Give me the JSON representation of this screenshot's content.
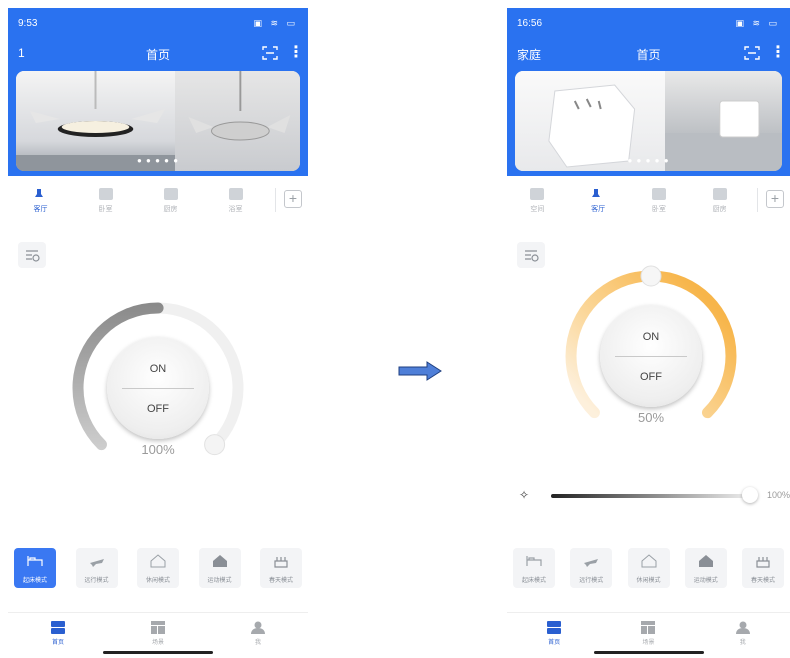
{
  "left_screen": {
    "status": {
      "time": "9:53"
    },
    "appbar": {
      "home_name": "1",
      "title": "首页"
    },
    "rooms": [
      {
        "label": "客厅",
        "active": true
      },
      {
        "label": "卧室",
        "active": false
      },
      {
        "label": "厨房",
        "active": false
      },
      {
        "label": "浴室",
        "active": false
      }
    ],
    "dial": {
      "on_label": "ON",
      "off_label": "OFF",
      "percent_text": "100%"
    },
    "modes": [
      {
        "label": "起床模式",
        "active": true,
        "icon": "bed-icon"
      },
      {
        "label": "远行模式",
        "active": false,
        "icon": "plane-icon"
      },
      {
        "label": "休闲模式",
        "active": false,
        "icon": "house-outline-icon"
      },
      {
        "label": "运动模式",
        "active": false,
        "icon": "house-filled-icon"
      },
      {
        "label": "春天模式",
        "active": false,
        "icon": "cake-icon"
      }
    ],
    "nav": [
      {
        "label": "首页",
        "active": true,
        "icon": "home-tab-icon"
      },
      {
        "label": "场景",
        "active": false,
        "icon": "scene-tab-icon"
      },
      {
        "label": "我",
        "active": false,
        "icon": "profile-tab-icon"
      }
    ]
  },
  "right_screen": {
    "status": {
      "time": "16:56"
    },
    "appbar": {
      "home_name": "家庭",
      "title": "首页"
    },
    "rooms": [
      {
        "label": "空间",
        "active": false
      },
      {
        "label": "客厅",
        "active": true
      },
      {
        "label": "卧室",
        "active": false
      },
      {
        "label": "厨房",
        "active": false
      }
    ],
    "dial": {
      "on_label": "ON",
      "off_label": "OFF",
      "percent_text": "50%",
      "level_percent": 50
    },
    "brightness": {
      "value_text": "100%",
      "level_percent": 100
    },
    "modes": [
      {
        "label": "起床模式",
        "active": false,
        "icon": "bed-icon"
      },
      {
        "label": "远行模式",
        "active": false,
        "icon": "plane-icon"
      },
      {
        "label": "休闲模式",
        "active": false,
        "icon": "house-outline-icon"
      },
      {
        "label": "运动模式",
        "active": false,
        "icon": "house-filled-icon"
      },
      {
        "label": "春天模式",
        "active": false,
        "icon": "cake-icon"
      }
    ],
    "nav": [
      {
        "label": "首页",
        "active": true,
        "icon": "home-tab-icon"
      },
      {
        "label": "场景",
        "active": false,
        "icon": "scene-tab-icon"
      },
      {
        "label": "我",
        "active": false,
        "icon": "profile-tab-icon"
      }
    ]
  },
  "colors": {
    "primary": "#2a72f0",
    "mode_active": "#3a78f2",
    "arc_warm": "#f7b54a",
    "arc_gray": "#8f8f8f"
  },
  "transition_icon": "right-arrow-icon"
}
